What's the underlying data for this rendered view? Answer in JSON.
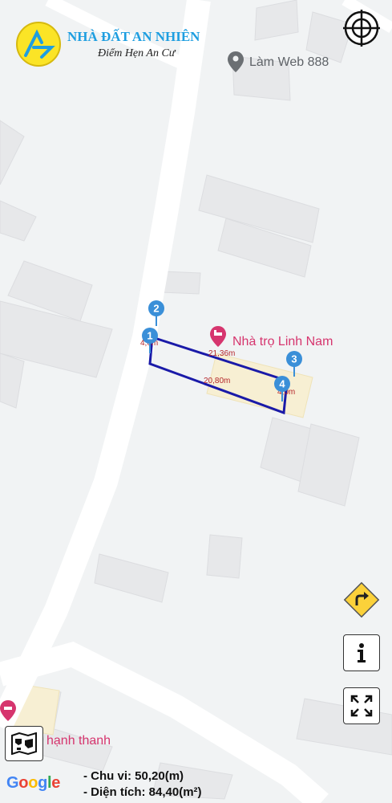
{
  "brand": {
    "title": "NHÀ ĐẤT AN NHIÊN",
    "slogan": "Điểm Hẹn An Cư",
    "logo_icon": "brand-logo-icon",
    "logo_color": "#fbe426",
    "accent_color": "#1e9ee0"
  },
  "map": {
    "pois": [
      {
        "name": "Làm Web 888",
        "icon": "map-pin-icon",
        "color": "#5f6368"
      },
      {
        "name": "Nhà trọ Linh Nam",
        "icon": "hotel-icon",
        "color": "#d6356e"
      },
      {
        "name": "hạnh thanh",
        "icon": "hotel-icon",
        "color": "#d6356e"
      }
    ],
    "markers": [
      "1",
      "2",
      "3",
      "4"
    ],
    "marker_color": "#3a8fd8",
    "plot_outline_color": "#1a1aa8",
    "dimensions": {
      "top_edge": "21,36m",
      "bottom_edge": "20,80m",
      "left_edge": "4,0m",
      "right_edge": "4,0m"
    },
    "dimension_color": "#b5272b",
    "attribution": "Google"
  },
  "controls": {
    "locate_icon": "crosshair-icon",
    "directions_icon": "directions-turn-right-icon",
    "info_icon": "info-icon",
    "fullscreen_icon": "fullscreen-icon",
    "map_type_icon": "map-layers-icon"
  },
  "plot_info": {
    "perimeter": "- Chu vi: 50,20(m)",
    "area": "- Diện tích: 84,40(m²)"
  }
}
